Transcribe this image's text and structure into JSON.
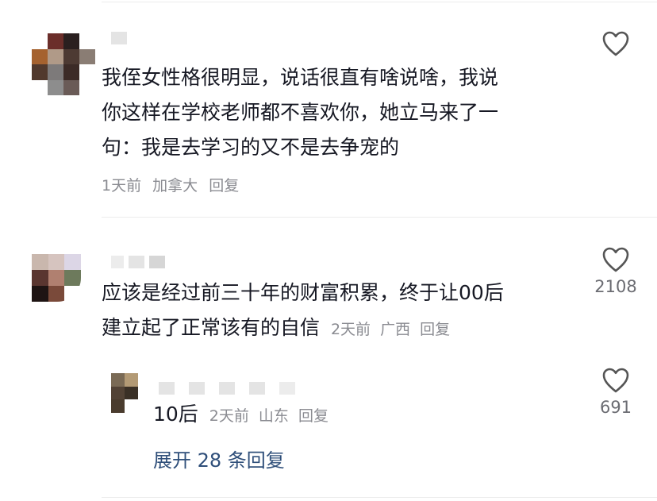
{
  "comments": [
    {
      "text_lines": [
        "我侄女性格很明显，说话很直有啥说啥，我说",
        "你这样在学校老师都不喜欢你，她立马来了一",
        "句：我是去学习的又不是去争宠的"
      ],
      "time": "1天前",
      "location": "加拿大",
      "reply_label": "回复",
      "like_count": ""
    },
    {
      "text_lines": [
        "应该是经过前三十年的财富积累，终于让00后",
        "建立起了正常该有的自信"
      ],
      "time": "2天前",
      "location": "广西",
      "reply_label": "回复",
      "like_count": "2108"
    }
  ],
  "reply": {
    "text": "10后",
    "time": "2天前",
    "location": "山东",
    "reply_label": "回复",
    "like_count": "691"
  },
  "expand_label": "展开 28 条回复",
  "colors": {
    "text": "#161823",
    "meta": "#8a8b91",
    "link": "#2f4f7a"
  },
  "icons": {
    "like": "heart-outline-icon"
  }
}
